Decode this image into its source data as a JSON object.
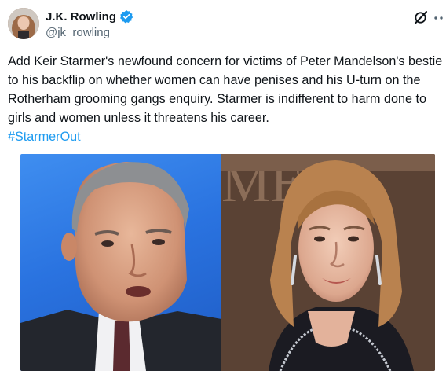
{
  "author": {
    "display_name": "J.K. Rowling",
    "handle": "@jk_rowling",
    "verified_color": "#1d9bf0"
  },
  "header_actions": {
    "grok_icon": "grok-icon",
    "more_icon": "more-icon"
  },
  "tweet": {
    "text": "Add Keir Starmer's newfound concern for victims of Peter Mandelson's bestie to his backflip on whether women can have penises and his U-turn on the Rotherham grooming gangs enquiry. Starmer is indifferent to harm done to girls and women unless it threatens his career.",
    "hashtag": "#StarmerOut",
    "hashtag_color": "#1d9bf0"
  },
  "media": {
    "images": [
      "photo-man-blue-background",
      "photo-woman-red-carpet"
    ],
    "backdrop_text": "MEDI"
  }
}
